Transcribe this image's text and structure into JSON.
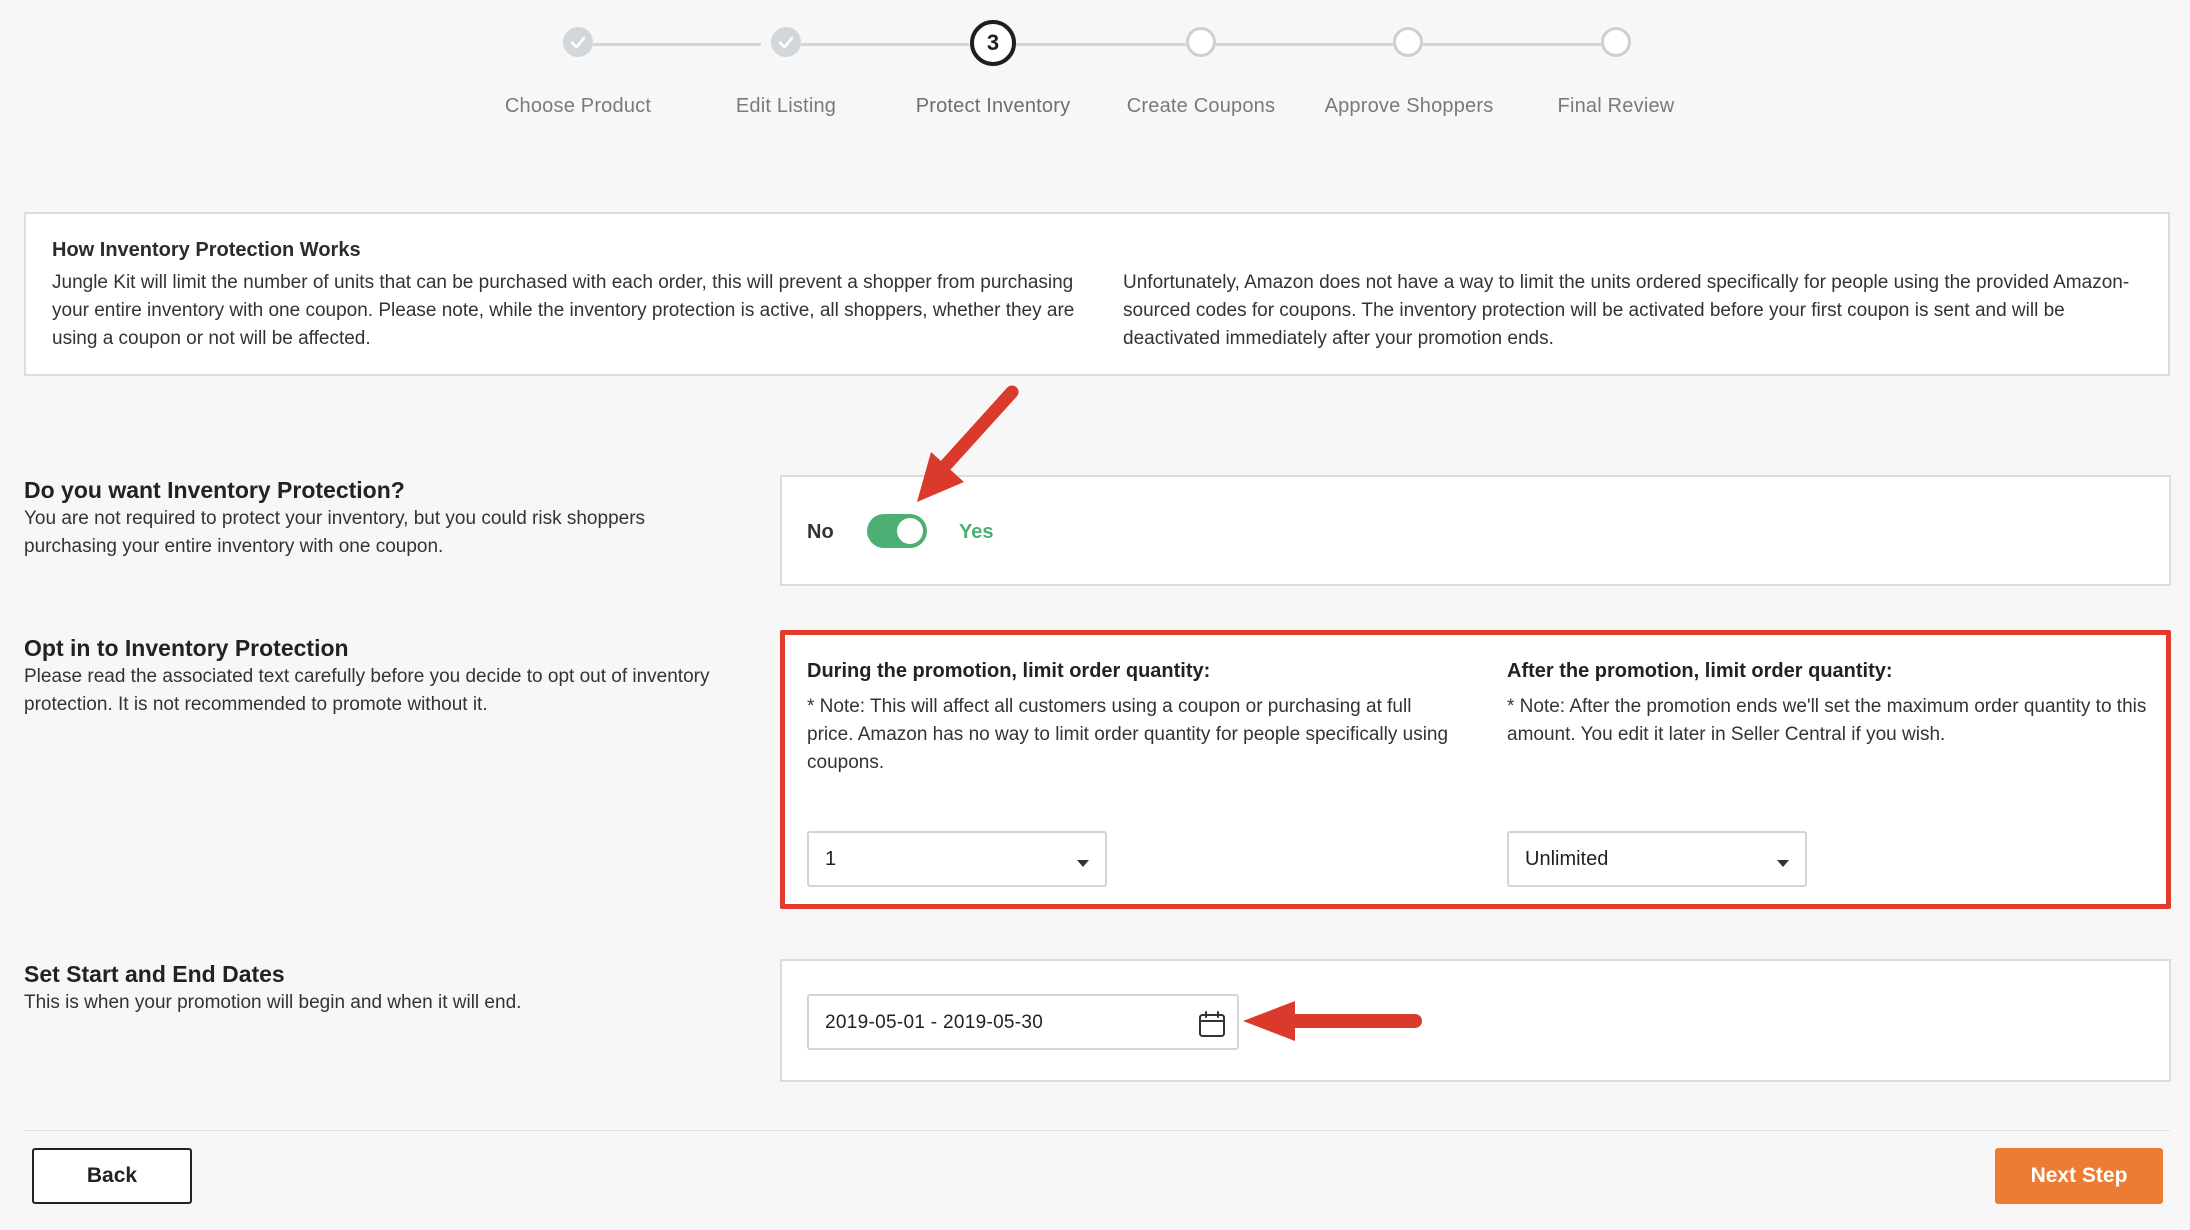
{
  "stepper": {
    "steps": [
      {
        "label": "Choose Product",
        "state": "done"
      },
      {
        "label": "Edit Listing",
        "state": "done"
      },
      {
        "label": "Protect Inventory",
        "state": "active",
        "number": "3"
      },
      {
        "label": "Create Coupons",
        "state": "todo"
      },
      {
        "label": "Approve Shoppers",
        "state": "todo"
      },
      {
        "label": "Final Review",
        "state": "todo"
      }
    ]
  },
  "info": {
    "title": "How Inventory Protection Works",
    "left_text": "Jungle Kit will limit the number of units that can be purchased with each order, this will prevent a shopper from purchasing your entire inventory with one coupon. Please note, while the inventory protection is active, all shoppers, whether they are using a coupon or not will be affected.",
    "right_text": "Unfortunately, Amazon does not have a way to limit the units ordered specifically for people using the provided Amazon-sourced codes for coupons. The inventory protection will be activated before your first coupon is sent and will be deactivated immediately after your promotion ends."
  },
  "protection": {
    "title": "Do you want Inventory Protection?",
    "description": "You are not required to protect your inventory, but you could risk shoppers purchasing your entire inventory with one coupon.",
    "toggle_off_label": "No",
    "toggle_on_label": "Yes",
    "toggle_on": true
  },
  "opt_in": {
    "title": "Opt in to Inventory Protection",
    "description": "Please read the associated text carefully before you decide to opt out of inventory protection. It is not recommended to promote without it.",
    "during": {
      "title": "During the promotion, limit order quantity:",
      "note": "* Note: This will affect all customers using a coupon or purchasing at full price. Amazon has no way to limit order quantity for people specifically using coupons.",
      "value": "1"
    },
    "after": {
      "title": "After the promotion, limit order quantity:",
      "note": "* Note: After the promotion ends we'll set the maximum order quantity to this amount. You edit it later in Seller Central if you wish.",
      "value": "Unlimited"
    }
  },
  "dates": {
    "title": "Set Start and End Dates",
    "description": "This is when your promotion will begin and when it will end.",
    "range": "2019-05-01 - 2019-05-30"
  },
  "footer": {
    "back_label": "Back",
    "next_label": "Next Step"
  },
  "colors": {
    "accent_orange": "#ec7b33",
    "toggle_green": "#4caf73",
    "highlight_red": "#e23b2e",
    "arrow_red": "#d93a2b"
  },
  "icons": {
    "step_done": "check-icon",
    "date": "calendar-icon",
    "select": "caret-down-icon"
  }
}
